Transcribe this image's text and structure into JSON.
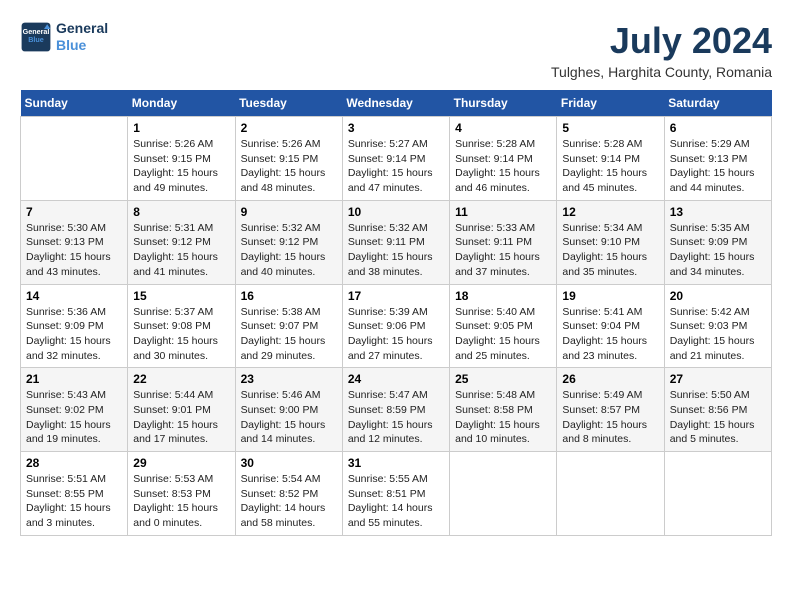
{
  "header": {
    "logo_line1": "General",
    "logo_line2": "Blue",
    "month": "July 2024",
    "location": "Tulghes, Harghita County, Romania"
  },
  "weekdays": [
    "Sunday",
    "Monday",
    "Tuesday",
    "Wednesday",
    "Thursday",
    "Friday",
    "Saturday"
  ],
  "weeks": [
    [
      {
        "day": "",
        "info": ""
      },
      {
        "day": "1",
        "info": "Sunrise: 5:26 AM\nSunset: 9:15 PM\nDaylight: 15 hours\nand 49 minutes."
      },
      {
        "day": "2",
        "info": "Sunrise: 5:26 AM\nSunset: 9:15 PM\nDaylight: 15 hours\nand 48 minutes."
      },
      {
        "day": "3",
        "info": "Sunrise: 5:27 AM\nSunset: 9:14 PM\nDaylight: 15 hours\nand 47 minutes."
      },
      {
        "day": "4",
        "info": "Sunrise: 5:28 AM\nSunset: 9:14 PM\nDaylight: 15 hours\nand 46 minutes."
      },
      {
        "day": "5",
        "info": "Sunrise: 5:28 AM\nSunset: 9:14 PM\nDaylight: 15 hours\nand 45 minutes."
      },
      {
        "day": "6",
        "info": "Sunrise: 5:29 AM\nSunset: 9:13 PM\nDaylight: 15 hours\nand 44 minutes."
      }
    ],
    [
      {
        "day": "7",
        "info": "Sunrise: 5:30 AM\nSunset: 9:13 PM\nDaylight: 15 hours\nand 43 minutes."
      },
      {
        "day": "8",
        "info": "Sunrise: 5:31 AM\nSunset: 9:12 PM\nDaylight: 15 hours\nand 41 minutes."
      },
      {
        "day": "9",
        "info": "Sunrise: 5:32 AM\nSunset: 9:12 PM\nDaylight: 15 hours\nand 40 minutes."
      },
      {
        "day": "10",
        "info": "Sunrise: 5:32 AM\nSunset: 9:11 PM\nDaylight: 15 hours\nand 38 minutes."
      },
      {
        "day": "11",
        "info": "Sunrise: 5:33 AM\nSunset: 9:11 PM\nDaylight: 15 hours\nand 37 minutes."
      },
      {
        "day": "12",
        "info": "Sunrise: 5:34 AM\nSunset: 9:10 PM\nDaylight: 15 hours\nand 35 minutes."
      },
      {
        "day": "13",
        "info": "Sunrise: 5:35 AM\nSunset: 9:09 PM\nDaylight: 15 hours\nand 34 minutes."
      }
    ],
    [
      {
        "day": "14",
        "info": "Sunrise: 5:36 AM\nSunset: 9:09 PM\nDaylight: 15 hours\nand 32 minutes."
      },
      {
        "day": "15",
        "info": "Sunrise: 5:37 AM\nSunset: 9:08 PM\nDaylight: 15 hours\nand 30 minutes."
      },
      {
        "day": "16",
        "info": "Sunrise: 5:38 AM\nSunset: 9:07 PM\nDaylight: 15 hours\nand 29 minutes."
      },
      {
        "day": "17",
        "info": "Sunrise: 5:39 AM\nSunset: 9:06 PM\nDaylight: 15 hours\nand 27 minutes."
      },
      {
        "day": "18",
        "info": "Sunrise: 5:40 AM\nSunset: 9:05 PM\nDaylight: 15 hours\nand 25 minutes."
      },
      {
        "day": "19",
        "info": "Sunrise: 5:41 AM\nSunset: 9:04 PM\nDaylight: 15 hours\nand 23 minutes."
      },
      {
        "day": "20",
        "info": "Sunrise: 5:42 AM\nSunset: 9:03 PM\nDaylight: 15 hours\nand 21 minutes."
      }
    ],
    [
      {
        "day": "21",
        "info": "Sunrise: 5:43 AM\nSunset: 9:02 PM\nDaylight: 15 hours\nand 19 minutes."
      },
      {
        "day": "22",
        "info": "Sunrise: 5:44 AM\nSunset: 9:01 PM\nDaylight: 15 hours\nand 17 minutes."
      },
      {
        "day": "23",
        "info": "Sunrise: 5:46 AM\nSunset: 9:00 PM\nDaylight: 15 hours\nand 14 minutes."
      },
      {
        "day": "24",
        "info": "Sunrise: 5:47 AM\nSunset: 8:59 PM\nDaylight: 15 hours\nand 12 minutes."
      },
      {
        "day": "25",
        "info": "Sunrise: 5:48 AM\nSunset: 8:58 PM\nDaylight: 15 hours\nand 10 minutes."
      },
      {
        "day": "26",
        "info": "Sunrise: 5:49 AM\nSunset: 8:57 PM\nDaylight: 15 hours\nand 8 minutes."
      },
      {
        "day": "27",
        "info": "Sunrise: 5:50 AM\nSunset: 8:56 PM\nDaylight: 15 hours\nand 5 minutes."
      }
    ],
    [
      {
        "day": "28",
        "info": "Sunrise: 5:51 AM\nSunset: 8:55 PM\nDaylight: 15 hours\nand 3 minutes."
      },
      {
        "day": "29",
        "info": "Sunrise: 5:53 AM\nSunset: 8:53 PM\nDaylight: 15 hours\nand 0 minutes."
      },
      {
        "day": "30",
        "info": "Sunrise: 5:54 AM\nSunset: 8:52 PM\nDaylight: 14 hours\nand 58 minutes."
      },
      {
        "day": "31",
        "info": "Sunrise: 5:55 AM\nSunset: 8:51 PM\nDaylight: 14 hours\nand 55 minutes."
      },
      {
        "day": "",
        "info": ""
      },
      {
        "day": "",
        "info": ""
      },
      {
        "day": "",
        "info": ""
      }
    ]
  ]
}
